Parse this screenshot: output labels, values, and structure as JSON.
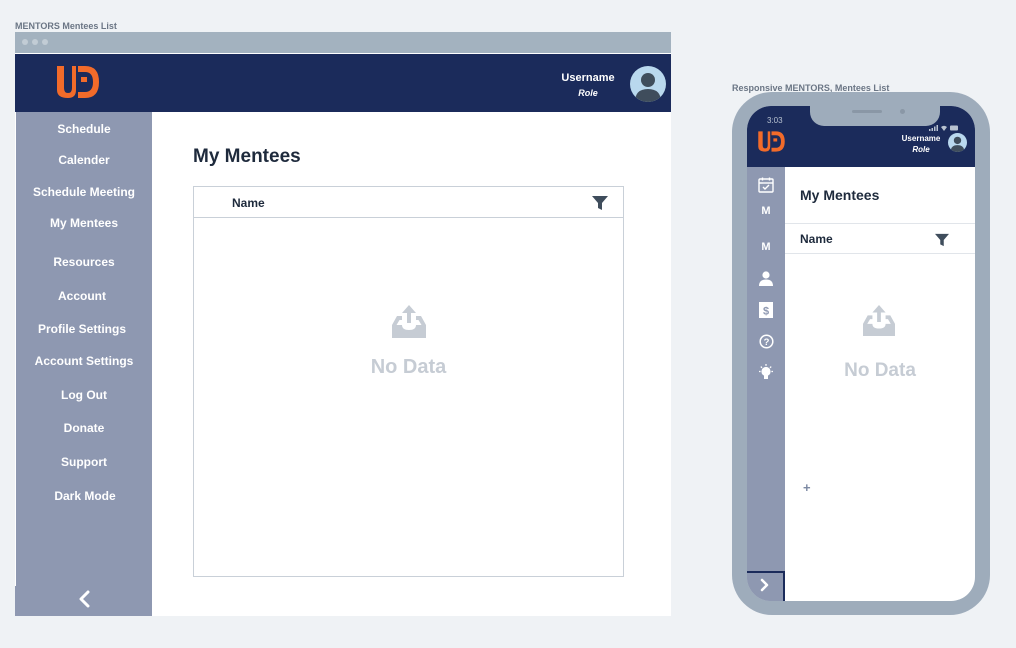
{
  "desktop": {
    "frame_label": "MENTORS Mentees List",
    "header": {
      "username": "Username",
      "role": "Role"
    },
    "sidebar": {
      "items": [
        {
          "label": "Schedule"
        },
        {
          "label": "Calender"
        },
        {
          "label": "Schedule Meeting"
        },
        {
          "label": "My Mentees"
        },
        {
          "label": "Resources"
        },
        {
          "label": "Account"
        },
        {
          "label": "Profile Settings"
        },
        {
          "label": "Account Settings"
        },
        {
          "label": "Log Out"
        },
        {
          "label": "Donate"
        },
        {
          "label": "Support"
        },
        {
          "label": "Dark Mode"
        }
      ],
      "collapse_icon": "chevron-left-icon"
    },
    "main": {
      "title": "My Mentees",
      "table": {
        "column": "Name",
        "filter_icon": "filter-icon",
        "empty_icon": "inbox-upload-icon",
        "empty_text": "No Data"
      }
    }
  },
  "mobile": {
    "frame_label": "Responsive MENTORS,  Mentees List",
    "status_time": "3:03",
    "header": {
      "username": "Username",
      "role": "Role"
    },
    "sidebar": {
      "items": [
        {
          "icon": "calendar-check-icon",
          "label": ""
        },
        {
          "icon": "",
          "label": "M"
        },
        {
          "icon": "",
          "label": "M"
        },
        {
          "icon": "user-icon",
          "label": ""
        },
        {
          "icon": "dollar-icon",
          "label": ""
        },
        {
          "icon": "help-icon",
          "label": ""
        },
        {
          "icon": "lightbulb-icon",
          "label": ""
        }
      ],
      "expand_icon": "chevron-right-icon"
    },
    "main": {
      "title": "My Mentees",
      "table": {
        "column": "Name",
        "filter_icon": "filter-icon",
        "empty_icon": "inbox-upload-icon",
        "empty_text": "No Data"
      },
      "add_label": "+"
    }
  },
  "colors": {
    "header": "#1b2b5b",
    "sidebar": "#8e98b1",
    "logo": "#f26b2a",
    "empty": "#c6ccd4",
    "page_bg": "#eff2f5"
  }
}
